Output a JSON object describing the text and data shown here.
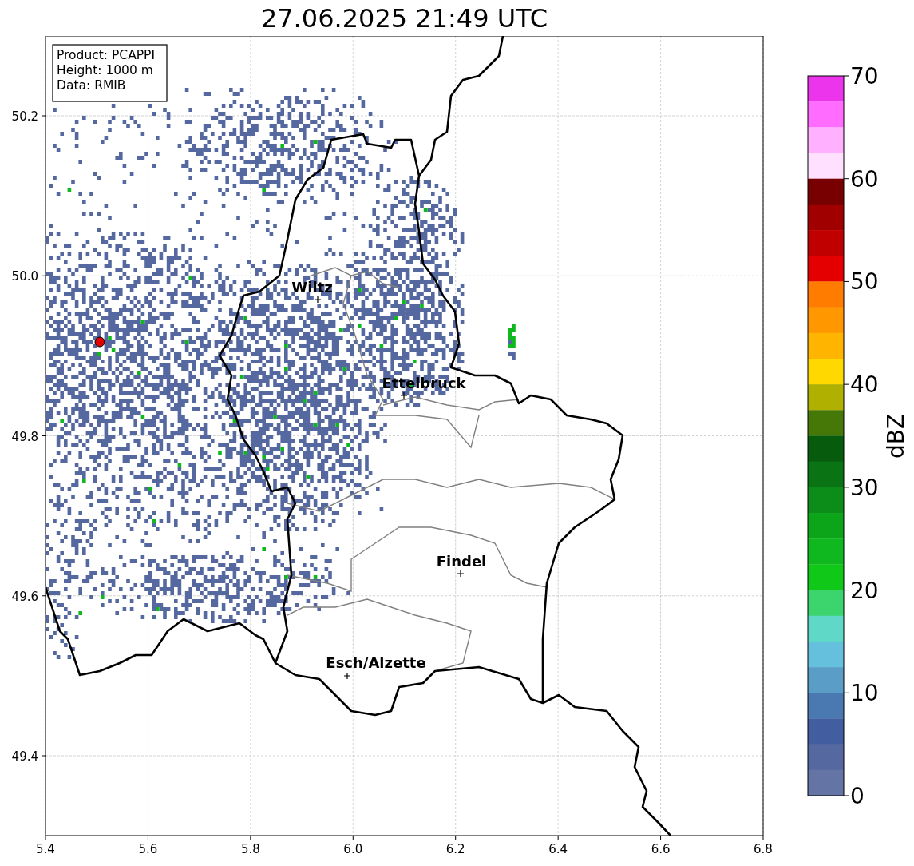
{
  "title": "27.06.2025 21:49 UTC",
  "info_box": [
    "Product: PCAPPI",
    "Height: 1000 m",
    "Data: RMIB"
  ],
  "map": {
    "xticks": [
      "5.4",
      "5.6",
      "5.8",
      "6.0",
      "6.2",
      "6.4",
      "6.6",
      "6.8"
    ],
    "yticks": [
      "50.2",
      "50.0",
      "49.8",
      "49.6",
      "49.4"
    ],
    "places": [
      {
        "name": "Wiltz"
      },
      {
        "name": "Ettelbruck"
      },
      {
        "name": "Findel"
      },
      {
        "name": "Esch/Alzette"
      }
    ]
  },
  "colorbar": {
    "label": "dBZ",
    "ticks": [
      "70",
      "60",
      "50",
      "40",
      "30",
      "20",
      "10",
      "0"
    ],
    "segments": [
      {
        "color": "#ec34ec"
      },
      {
        "color": "#ff6cff"
      },
      {
        "color": "#ffb0ff"
      },
      {
        "color": "#ffe0ff"
      },
      {
        "color": "#780000"
      },
      {
        "color": "#a00000"
      },
      {
        "color": "#c00000"
      },
      {
        "color": "#e40000"
      },
      {
        "color": "#ff7c00"
      },
      {
        "color": "#ff9800"
      },
      {
        "color": "#ffb400"
      },
      {
        "color": "#ffd800"
      },
      {
        "color": "#b0b000"
      },
      {
        "color": "#467808"
      },
      {
        "color": "#065c0c"
      },
      {
        "color": "#0a7414"
      },
      {
        "color": "#0c8c18"
      },
      {
        "color": "#0ca418"
      },
      {
        "color": "#10b820"
      },
      {
        "color": "#10c818"
      },
      {
        "color": "#3cd46c"
      },
      {
        "color": "#60d8c8"
      },
      {
        "color": "#64c0dc"
      },
      {
        "color": "#5a9ec8"
      },
      {
        "color": "#4a78b0"
      },
      {
        "color": "#435ea0"
      },
      {
        "color": "#5568a0"
      },
      {
        "color": "#6474a4"
      }
    ]
  }
}
